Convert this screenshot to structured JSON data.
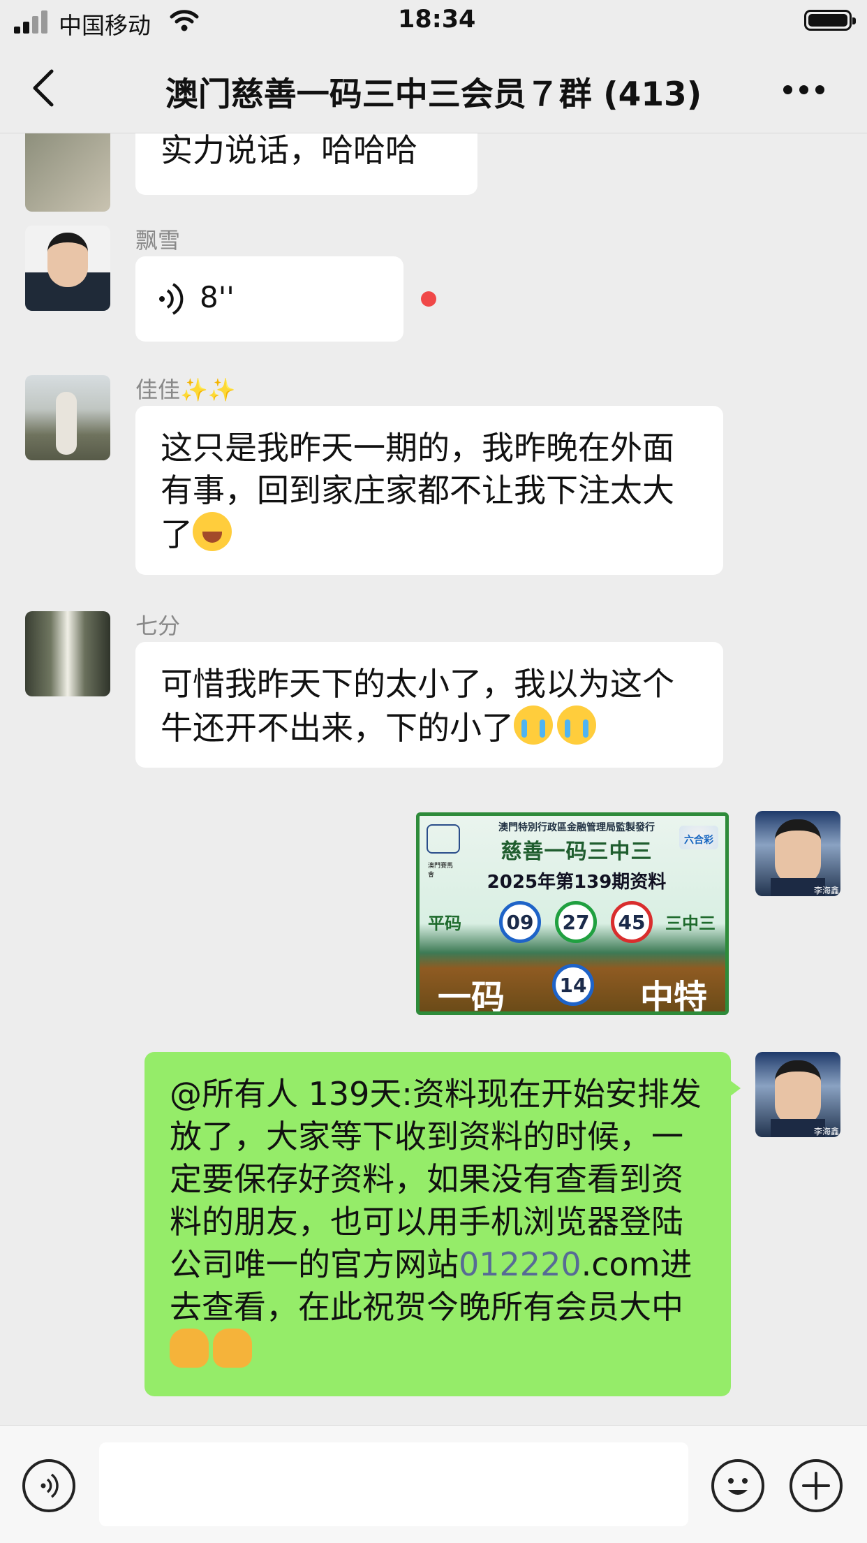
{
  "status_bar": {
    "carrier": "中国移动",
    "time": "18:34"
  },
  "nav": {
    "title": "澳门慈善一码三中三会员７群 (413)",
    "back_icon": "chevron-left-icon",
    "more_icon": "ellipsis-icon"
  },
  "messages": [
    {
      "type": "text",
      "side": "left",
      "nick": "",
      "text": "实力说话，哈哈哈"
    },
    {
      "type": "voice",
      "side": "left",
      "nick": "飘雪",
      "duration": "8''",
      "unread": true
    },
    {
      "type": "text",
      "side": "left",
      "nick": "佳佳✨✨",
      "text": "这只是我昨天一期的，我昨晚在外面有事，回到家庄家都不让我下注太大了",
      "emoji": [
        "laugh-emoji"
      ]
    },
    {
      "type": "text",
      "side": "left",
      "nick": "七分",
      "text": "可惜我昨天下的太小了，我以为这个牛还开不出来，下的小了",
      "emoji": [
        "cry-emoji",
        "cry-emoji"
      ]
    },
    {
      "type": "image",
      "side": "right",
      "avatar_label": "李海鑫",
      "image": {
        "header": "澳門特別行政區金融管理局監製發行",
        "left_logo_text": "澳門賽馬會",
        "right_logo_text": "六合彩",
        "title": "慈善一码三中三",
        "subtitle": "2025年第139期资料",
        "left_label": "平码",
        "right_label": "三中三",
        "numbers": [
          "09",
          "27",
          "45"
        ],
        "bottom_left": "一码",
        "special": "14",
        "bottom_right": "中特"
      }
    },
    {
      "type": "text",
      "side": "right",
      "avatar_label": "李海鑫",
      "text_before_link": "@所有人 139天:资料现在开始安排发放了，大家等下收到资料的时候，一定要保存好资料，如果没有查看到资料的朋友，也可以用手机浏览器登陆公司唯一的官方网站",
      "link": "012220",
      "text_after_link": ".com进去查看，在此祝贺今晚所有会员大中",
      "emoji": [
        "handshake-emoji",
        "handshake-emoji"
      ]
    }
  ],
  "input_bar": {
    "voice_icon": "voice-icon",
    "emoji_icon": "smile-icon",
    "add_icon": "plus-icon",
    "input_value": ""
  },
  "colors": {
    "background": "#ededed",
    "bubble_self": "#95ec69",
    "bubble_other": "#ffffff",
    "link": "#576b95",
    "unread": "#f04848"
  }
}
